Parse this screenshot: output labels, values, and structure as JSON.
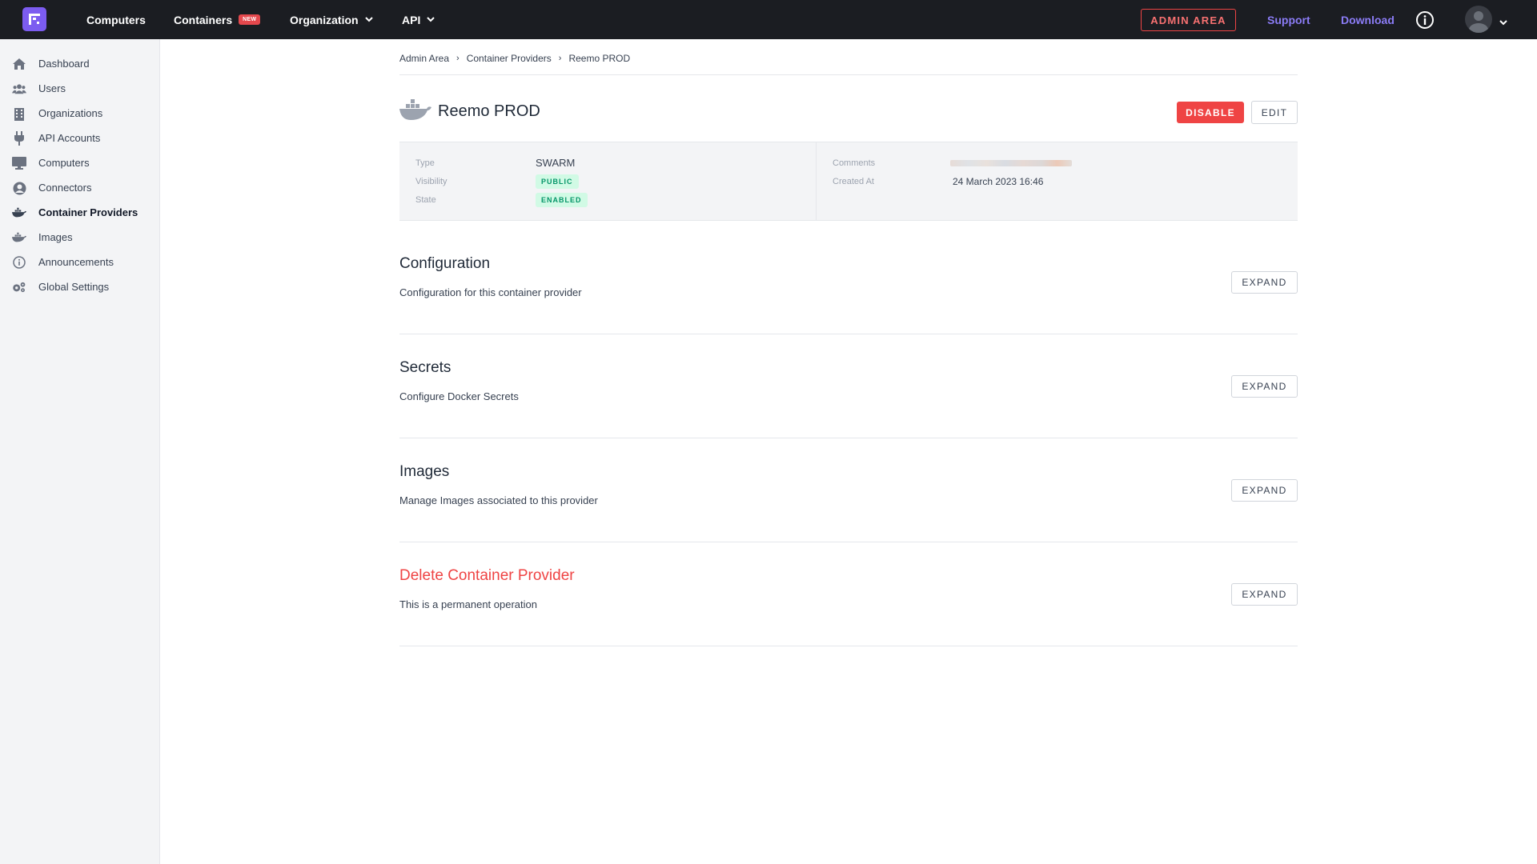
{
  "topnav": {
    "items": [
      {
        "label": "Computers"
      },
      {
        "label": "Containers",
        "badge": "NEW"
      },
      {
        "label": "Organization"
      },
      {
        "label": "API"
      }
    ],
    "admin_area": "ADMIN AREA",
    "support": "Support",
    "download": "Download"
  },
  "sidebar": {
    "items": [
      {
        "label": "Dashboard",
        "icon": "home-icon"
      },
      {
        "label": "Users",
        "icon": "users-icon"
      },
      {
        "label": "Organizations",
        "icon": "building-icon"
      },
      {
        "label": "API Accounts",
        "icon": "plug-icon"
      },
      {
        "label": "Computers",
        "icon": "monitor-icon"
      },
      {
        "label": "Connectors",
        "icon": "user-circle-icon"
      },
      {
        "label": "Container Providers",
        "icon": "docker-icon",
        "active": true
      },
      {
        "label": "Images",
        "icon": "docker-icon"
      },
      {
        "label": "Announcements",
        "icon": "info-circle-icon"
      },
      {
        "label": "Global Settings",
        "icon": "cogs-icon"
      }
    ]
  },
  "breadcrumb": [
    "Admin Area",
    "Container Providers",
    "Reemo PROD"
  ],
  "provider": {
    "name": "Reemo PROD",
    "disable_label": "DISABLE",
    "edit_label": "EDIT",
    "type_label": "Type",
    "type_value": "SWARM",
    "visibility_label": "Visibility",
    "visibility_value": "PUBLIC",
    "state_label": "State",
    "state_value": "ENABLED",
    "comments_label": "Comments",
    "created_label": "Created At",
    "created_value": "24 March 2023 16:46"
  },
  "sections": [
    {
      "title": "Configuration",
      "desc": "Configuration for this container provider",
      "button": "EXPAND"
    },
    {
      "title": "Secrets",
      "desc": "Configure Docker Secrets",
      "button": "EXPAND"
    },
    {
      "title": "Images",
      "desc": "Manage Images associated to this provider",
      "button": "EXPAND"
    },
    {
      "title": "Delete Container Provider",
      "desc": "This is a permanent operation",
      "button": "EXPAND",
      "danger": true
    }
  ],
  "colors": {
    "accent": "#7c5cf0",
    "danger": "#ef4444",
    "topbar": "#1b1d22",
    "success_bg": "#d1fae5",
    "success_fg": "#059669"
  }
}
